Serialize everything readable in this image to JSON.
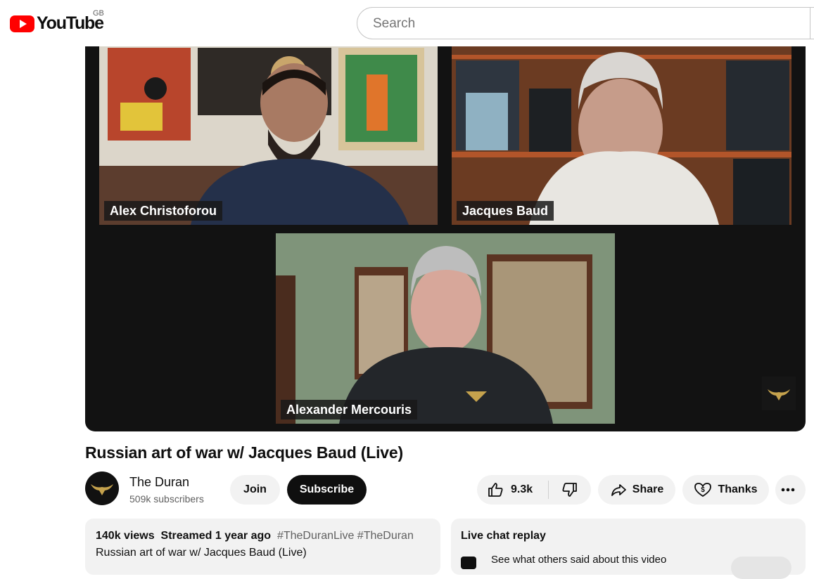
{
  "header": {
    "logo_text": "YouTube",
    "country_code": "GB",
    "search_placeholder": "Search"
  },
  "player": {
    "participants": [
      {
        "name": "Alex Christoforou"
      },
      {
        "name": "Jacques Baud"
      },
      {
        "name": "Alexander Mercouris"
      }
    ]
  },
  "video": {
    "title": "Russian art of war w/ Jacques Baud (Live)"
  },
  "owner": {
    "channel_name": "The Duran",
    "subscribers": "509k subscribers",
    "join_label": "Join",
    "subscribe_label": "Subscribe"
  },
  "actions": {
    "like_count": "9.3k",
    "share_label": "Share",
    "thanks_label": "Thanks"
  },
  "description": {
    "views": "140k views",
    "streamed": "Streamed 1 year ago",
    "hashtags": [
      "#TheDuranLive",
      "#TheDuran"
    ],
    "text": "Russian art of war w/ Jacques Baud (Live)"
  },
  "chat": {
    "title": "Live chat replay",
    "subtitle": "See what others said about this video"
  },
  "colors": {
    "brand_red": "#ff0000",
    "subscribe_bg": "#0f0f0f",
    "pill_bg": "#f2f2f2"
  },
  "icons": [
    "youtube-logo-icon",
    "like-icon",
    "dislike-icon",
    "share-icon",
    "thanks-icon",
    "more-icon",
    "chat-icon"
  ]
}
